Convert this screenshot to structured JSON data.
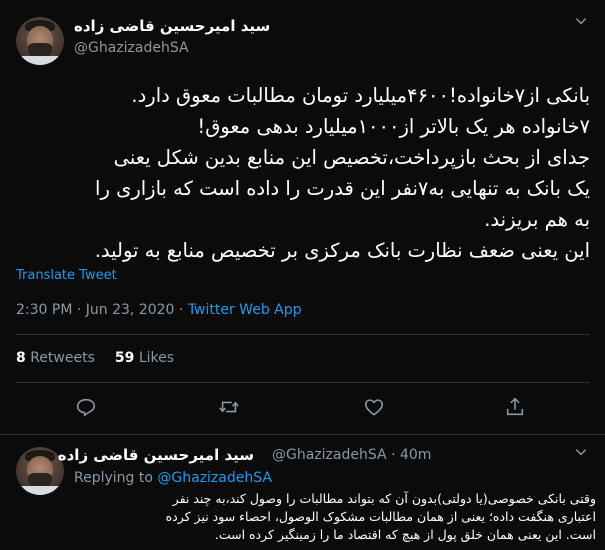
{
  "main_tweet": {
    "author_name": "سید امیرحسین قاضی زاده",
    "handle": "@GhazizadehSA",
    "body_lines": [
      "بانکی از۷خانواده!۴۶۰۰میلیارد تومان مطالبات معوق دارد.",
      "۷خانواده هر یک بالاتر از۱۰۰۰میلیارد بدهی معوق!",
      "جدای از بحث بازپرداخت،تخصیص این منابع بدین شکل یعنی",
      "یک بانک به تنهایی به۷نفر این قدرت را داده است که بازاری را",
      "به هم بریزند.",
      "این یعنی ضعف نظارت بانک مرکزی بر تخصیص منابع به تولید."
    ],
    "translate_label": "Translate Tweet",
    "time": "2:30 PM",
    "separator": " · ",
    "date": "Jun 23, 2020",
    "app": "Twitter Web App",
    "retweets_count": "8",
    "retweets_label": "Retweets",
    "likes_count": "59",
    "likes_label": "Likes"
  },
  "reply_tweet": {
    "author_name": "سید امیرحسین قاضی زاده",
    "handle": "@GhazizadehSA",
    "time_ago": "40m",
    "replying_label": "Replying to",
    "replying_to": "@GhazizadehSA",
    "body_lines": [
      "وقتی بانکی خصوصی(یا دولتی)بدون آن که بتواند مطالبات را وصول کند،به چند نفر",
      "اعتباری هنگفت داده؛ یعنی از همان مطالبات مشکوک الوصول، احصاء سود نیز کرده",
      "است. این یعنی همان خلق پول از هیچ که اقتصاد ما را زمینگیر کرده است."
    ]
  },
  "icons": {
    "caret": "chevron-down-icon",
    "reply": "reply-icon",
    "retweet": "retweet-icon",
    "like": "heart-icon",
    "share": "share-icon"
  },
  "colors": {
    "background": "#0b0b0b",
    "accent": "#1d9bf0",
    "muted": "#8b98a5",
    "divider": "#2f3336"
  }
}
